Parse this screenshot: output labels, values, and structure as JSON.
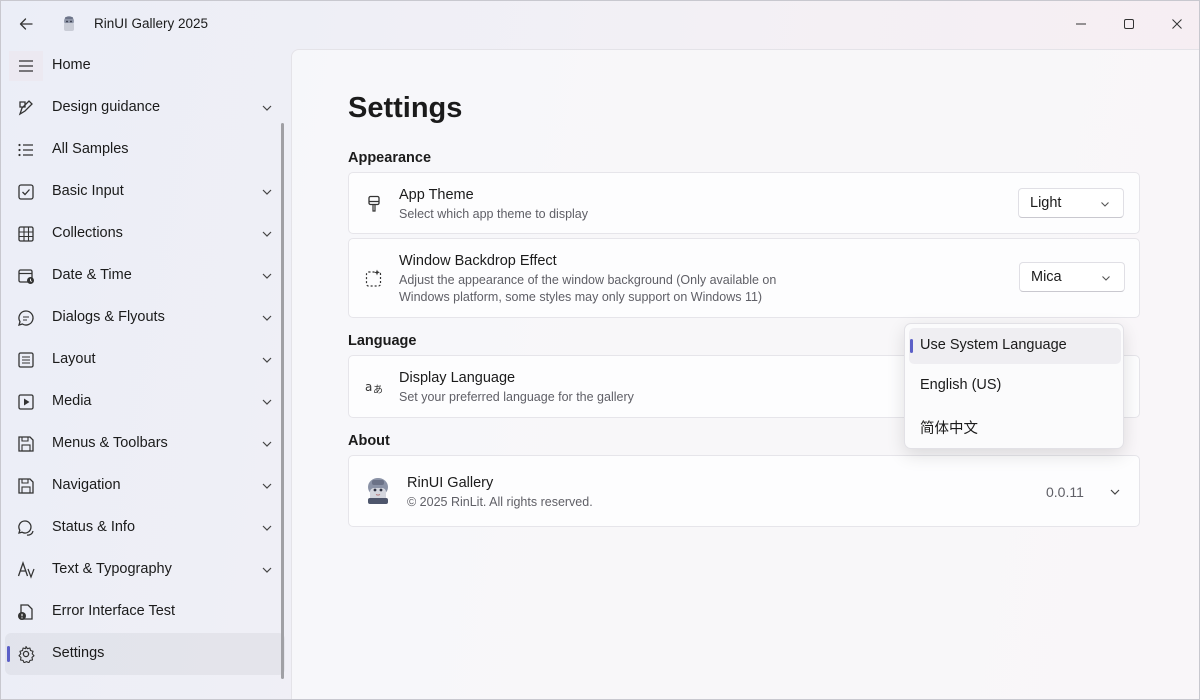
{
  "window": {
    "title": "RinUI Gallery 2025",
    "icons": {
      "back": "back-arrow-icon",
      "app": "app-logo-icon",
      "minimize": "minimize-icon",
      "maximize": "maximize-icon",
      "close": "close-icon"
    }
  },
  "sidebar": {
    "hamburger_icon": "hamburger-icon",
    "items": [
      {
        "label": "Home",
        "icon": "home-icon",
        "expandable": false,
        "selected": false
      },
      {
        "label": "Design guidance",
        "icon": "design-icon",
        "expandable": true,
        "selected": false
      },
      {
        "label": "All Samples",
        "icon": "list-icon",
        "expandable": false,
        "selected": false
      },
      {
        "label": "Basic Input",
        "icon": "checkbox-icon",
        "expandable": true,
        "selected": false
      },
      {
        "label": "Collections",
        "icon": "grid-icon",
        "expandable": true,
        "selected": false
      },
      {
        "label": "Date & Time",
        "icon": "calendar-clock-icon",
        "expandable": true,
        "selected": false
      },
      {
        "label": "Dialogs & Flyouts",
        "icon": "chat-icon",
        "expandable": true,
        "selected": false
      },
      {
        "label": "Layout",
        "icon": "layout-icon",
        "expandable": true,
        "selected": false
      },
      {
        "label": "Media",
        "icon": "play-icon",
        "expandable": true,
        "selected": false
      },
      {
        "label": "Menus & Toolbars",
        "icon": "save-icon",
        "expandable": true,
        "selected": false
      },
      {
        "label": "Navigation",
        "icon": "save-icon",
        "expandable": true,
        "selected": false
      },
      {
        "label": "Status & Info",
        "icon": "status-chat-icon",
        "expandable": true,
        "selected": false
      },
      {
        "label": "Text & Typography",
        "icon": "typography-icon",
        "expandable": true,
        "selected": false
      },
      {
        "label": "Error Interface Test",
        "icon": "error-document-icon",
        "expandable": false,
        "selected": false
      },
      {
        "label": "Settings",
        "icon": "gear-icon",
        "expandable": false,
        "selected": true
      }
    ]
  },
  "page": {
    "title": "Settings",
    "appearance": {
      "heading": "Appearance",
      "app_theme": {
        "title": "App Theme",
        "desc": "Select which app theme to display",
        "value": "Light",
        "icon": "paintbrush-icon"
      },
      "backdrop": {
        "title": "Window Backdrop Effect",
        "desc": "Adjust the appearance of the window background (Only available on Windows platform, some styles may only support on Windows 11)",
        "value": "Mica",
        "icon": "backdrop-sparkle-icon"
      }
    },
    "language": {
      "heading": "Language",
      "display": {
        "title": "Display Language",
        "desc": "Set your preferred language for the gallery",
        "icon": "language-icon"
      }
    },
    "about": {
      "heading": "About",
      "name": "RinUI Gallery",
      "copyright": "© 2025 RinLit. All rights reserved.",
      "version": "0.0.11",
      "icon": "app-logo-icon"
    }
  },
  "language_dropdown": {
    "options": [
      "Use System Language",
      "English (US)",
      "简体中文"
    ],
    "selected_index": 0
  },
  "colors": {
    "accent": "#5b5fc7"
  }
}
